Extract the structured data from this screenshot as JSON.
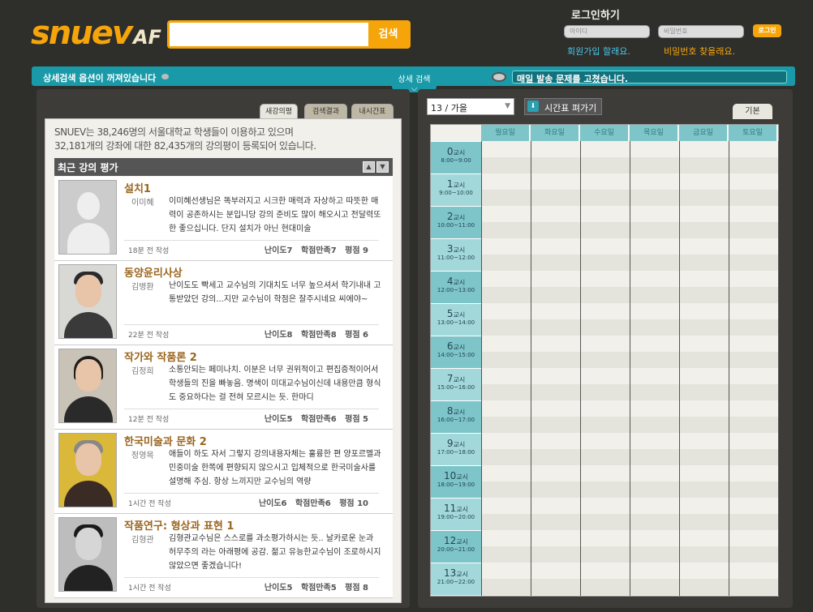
{
  "header": {
    "logo_main": "snuev",
    "logo_suffix": "AF",
    "search_placeholder": "",
    "search_button": "검색"
  },
  "login": {
    "title": "로그인하기",
    "id_placeholder": "아이디",
    "pw_placeholder": "비밀번호",
    "button": "로그인",
    "signup_link": "회원가입 할래요.",
    "findpw_link": "비밀번호 찾을래요."
  },
  "bar": {
    "left_text": "상세검색 옵션이 꺼져있습니다",
    "center_text": "상세 검색",
    "notice": "매일 발송 문제를 고쳤습니다."
  },
  "left": {
    "tabs": [
      "새강의평",
      "검색결과",
      "내시간표"
    ],
    "stats_line1": "SNUEV는 38,246명의 서울대학교 학생들이 이용하고 있으며",
    "stats_line2": "32,181개의 강좌에 대한 82,435개의 강의평이 등록되어 있습니다.",
    "reviews_header": "최근 강의 평가",
    "reviews": [
      {
        "course": "설치1",
        "prof": "이미혜",
        "text": "이미혜선생님은 똑부러지고 시크한 매력과 자상하고 따뜻한 매력이 공존하시는 분입니당 강의 준비도 많이 해오시고 전달력또한 좋으십니다. 단지 설치가 아닌 현대미술",
        "time": "18분 전 작성",
        "m1": "난이도7",
        "m2": "학점만족7",
        "m3": "평점 9"
      },
      {
        "course": "동양윤리사상",
        "prof": "김병환",
        "text": "난이도도 빡세고 교수님의 기대치도 너무 높으셔서 학기내내 고통받았던 강의...지만 교수님이 학점은 잘주시네요 씨에야~",
        "time": "22분 전 작성",
        "m1": "난이도8",
        "m2": "학점만족8",
        "m3": "평점 6"
      },
      {
        "course": "작가와 작품론 2",
        "prof": "김정희",
        "text": "소통안되는 페미나치. 이분은 너무 권위적이고 편집증적이어서 학생들의 진을 빠놓음. 명색이 미대교수님이신데 내용만큼 형식도 중요하다는 걸 전혀 모르시는 듯. 한마디",
        "time": "12분 전 작성",
        "m1": "난이도5",
        "m2": "학점만족6",
        "m3": "평점 5"
      },
      {
        "course": "한국미술과 문화 2",
        "prof": "정영목",
        "text": "애들이 하도 자서 그렇지 강의내용자체는 훌륭한 편 양포르멜과 민중미술 한쪽에 편향되지 않으시고 입체적으로 한국미술사를 설명해 주심. 항상 느끼지만 교수님의 역량",
        "time": "1시간 전 작성",
        "m1": "난이도6",
        "m2": "학점만족6",
        "m3": "평점 10"
      },
      {
        "course": "작품연구: 형상과 표현 1",
        "prof": "김형관",
        "text": "김형관교수님은 스스로를 과소평가하시는 듯.. 날카로운 눈과 허무주의 라는 아래평에 공감. 젊고 유능한교수님이 조로하시지 않았으면 좋겠습니다!",
        "time": "1시간 전 작성",
        "m1": "난이도5",
        "m2": "학점만족5",
        "m3": "평점 8"
      }
    ]
  },
  "right": {
    "semester": "13 / 가을",
    "edit_button": "시간표 펴가기",
    "basic_tab": "기본",
    "days": [
      "월요일",
      "화요일",
      "수요일",
      "목요일",
      "금요일",
      "토요일"
    ],
    "periods": [
      {
        "n": "0",
        "unit": "교시",
        "t": "8:00~9:00"
      },
      {
        "n": "1",
        "unit": "교시",
        "t": "9:00~10:00"
      },
      {
        "n": "2",
        "unit": "교시",
        "t": "10:00~11:00"
      },
      {
        "n": "3",
        "unit": "교시",
        "t": "11:00~12:00"
      },
      {
        "n": "4",
        "unit": "교시",
        "t": "12:00~13:00"
      },
      {
        "n": "5",
        "unit": "교시",
        "t": "13:00~14:00"
      },
      {
        "n": "6",
        "unit": "교시",
        "t": "14:00~15:00"
      },
      {
        "n": "7",
        "unit": "교시",
        "t": "15:00~16:00"
      },
      {
        "n": "8",
        "unit": "교시",
        "t": "16:00~17:00"
      },
      {
        "n": "9",
        "unit": "교시",
        "t": "17:00~18:00"
      },
      {
        "n": "10",
        "unit": "교시",
        "t": "18:00~19:00"
      },
      {
        "n": "11",
        "unit": "교시",
        "t": "19:00~20:00"
      },
      {
        "n": "12",
        "unit": "교시",
        "t": "20:00~21:00"
      },
      {
        "n": "13",
        "unit": "교시",
        "t": "21:00~22:00"
      }
    ]
  },
  "colors": {
    "accent": "#f5a50a",
    "teal": "#1a9aa8",
    "course": "#9a6620"
  }
}
